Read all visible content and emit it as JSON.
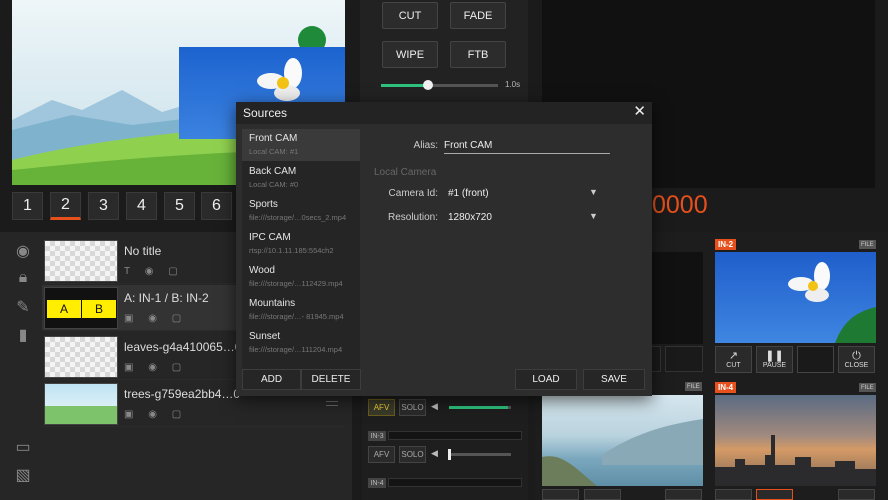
{
  "preview": {
    "numbers": [
      "1",
      "2",
      "3",
      "4",
      "5",
      "6"
    ],
    "active": "2"
  },
  "transitions": {
    "cut": "CUT",
    "fade": "FADE",
    "wipe": "WIPE",
    "ftb": "FTB",
    "duration": "1.0s",
    "duration_fraction": 0.4
  },
  "program": {
    "timer": "0000"
  },
  "layers": [
    {
      "title": "No title"
    },
    {
      "title": "A: IN-1 / B: IN-2",
      "a": "A",
      "b": "B"
    },
    {
      "title": "leaves-g4a410065…0"
    },
    {
      "title": "trees-g759ea2bb4…0"
    }
  ],
  "audio": {
    "afv": "AFV",
    "solo": "SOLO",
    "strips": [
      {
        "label": "IN-3",
        "level": 0.0
      },
      {
        "label": "IN-4",
        "level": 0.0
      }
    ],
    "main_level": 0.95
  },
  "inputs": {
    "in2": "IN-2",
    "in4": "IN-4",
    "file": "FILE",
    "cut": "CUT",
    "pause": "PAUSE",
    "close": "CLOSE"
  },
  "dialog": {
    "title": "Sources",
    "close": "✕",
    "sources": [
      {
        "name": "Front CAM",
        "sub": "Local CAM: #1"
      },
      {
        "name": "Back CAM",
        "sub": "Local CAM: #0"
      },
      {
        "name": "Sports",
        "sub": "file:///storage/…0secs_2.mp4"
      },
      {
        "name": "IPC CAM",
        "sub": "rtsp://10.1.11.185:554ch2"
      },
      {
        "name": "Wood",
        "sub": "file:///storage/…112429.mp4"
      },
      {
        "name": "Mountains",
        "sub": "file:///storage/…- 81945.mp4"
      },
      {
        "name": "Sunset",
        "sub": "file:///storage/…111204.mp4"
      }
    ],
    "add": "ADD",
    "delete": "DELETE",
    "alias_label": "Alias:",
    "alias_value": "Front CAM",
    "section": "Local Camera",
    "camera_label": "Camera Id:",
    "camera_value": "#1 (front)",
    "resolution_label": "Resolution:",
    "resolution_value": "1280x720",
    "load": "LOAD",
    "save": "SAVE"
  }
}
